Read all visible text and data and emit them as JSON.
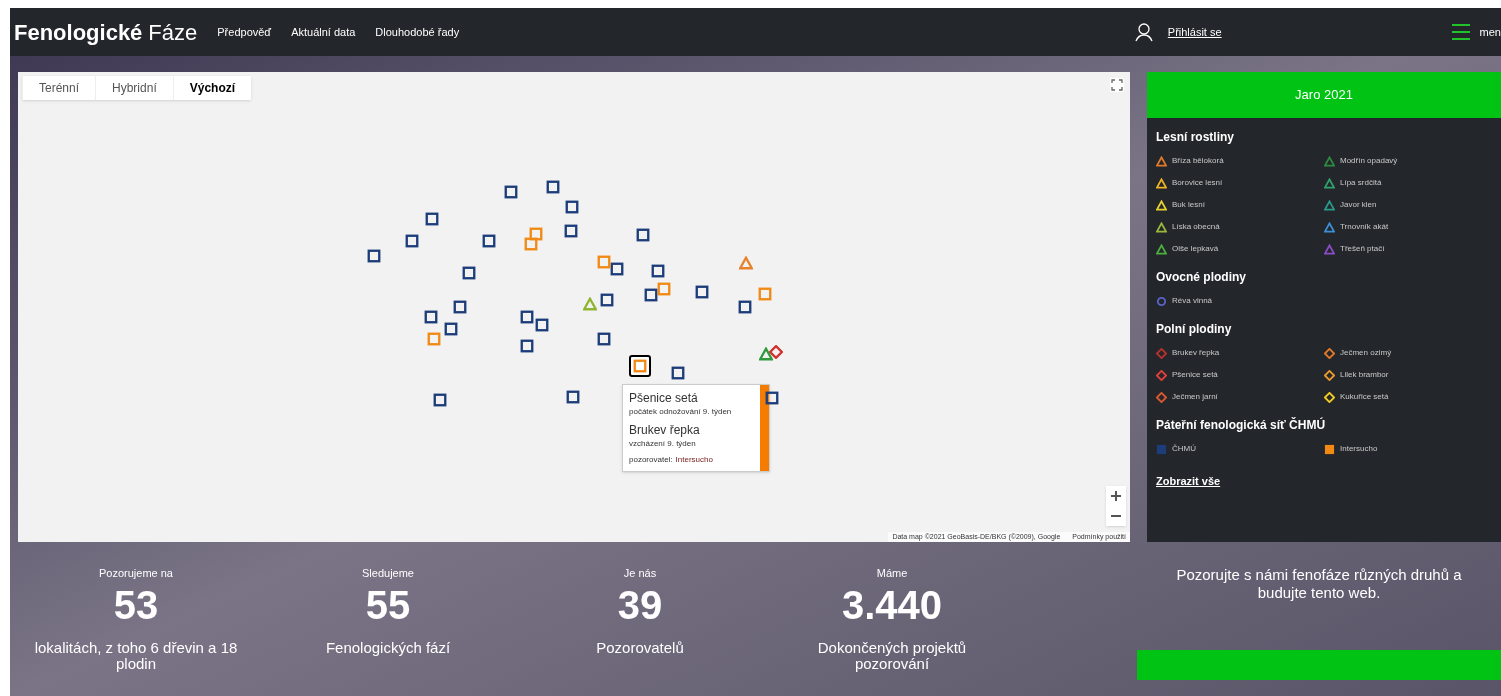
{
  "header": {
    "logo_bold": "Fenologické",
    "logo_light": "Fáze",
    "nav": [
      "Předpověď",
      "Aktuální data",
      "Dlouhodobé řady"
    ],
    "login": "Přihlásit se",
    "menu": "men"
  },
  "map": {
    "map_types": [
      {
        "label": "Terénní",
        "selected": false
      },
      {
        "label": "Hybridní",
        "selected": false
      },
      {
        "label": "Výchozí",
        "selected": true
      }
    ],
    "markers": [
      {
        "kind": "chmu",
        "selected": false
      },
      {
        "kind": "chmu",
        "selected": false
      },
      {
        "kind": "chmu",
        "selected": false
      },
      {
        "kind": "chmu",
        "selected": false
      },
      {
        "kind": "chmu",
        "selected": false
      },
      {
        "kind": "chmu",
        "selected": false
      },
      {
        "kind": "chmu",
        "selected": false
      },
      {
        "kind": "chmu",
        "selected": false
      },
      {
        "kind": "chmu",
        "selected": false
      },
      {
        "kind": "chmu",
        "selected": false
      },
      {
        "kind": "chmu",
        "selected": false
      },
      {
        "kind": "chmu",
        "selected": false
      },
      {
        "kind": "chmu",
        "selected": false
      },
      {
        "kind": "chmu",
        "selected": false
      },
      {
        "kind": "chmu",
        "selected": false
      },
      {
        "kind": "chmu",
        "selected": false
      },
      {
        "kind": "chmu",
        "selected": false
      },
      {
        "kind": "chmu",
        "selected": false
      },
      {
        "kind": "chmu",
        "selected": false
      },
      {
        "kind": "chmu",
        "selected": false
      },
      {
        "kind": "chmu",
        "selected": false
      },
      {
        "kind": "chmu",
        "selected": false
      },
      {
        "kind": "chmu",
        "selected": false
      },
      {
        "kind": "chmu",
        "selected": false
      },
      {
        "kind": "chmu",
        "selected": false
      },
      {
        "kind": "chmu",
        "selected": false
      },
      {
        "kind": "chmu",
        "selected": false
      },
      {
        "kind": "intersucho",
        "selected": false
      },
      {
        "kind": "intersucho",
        "selected": false
      },
      {
        "kind": "intersucho",
        "selected": false
      },
      {
        "kind": "intersucho",
        "selected": false
      },
      {
        "kind": "intersucho",
        "selected": false
      },
      {
        "kind": "intersucho",
        "selected": false
      },
      {
        "kind": "intersucho",
        "selected": true
      },
      {
        "kind": "triangle",
        "selected": false,
        "color": "#8fb431"
      },
      {
        "kind": "triangle",
        "selected": false,
        "color": "#e8822a"
      },
      {
        "kind": "diamond",
        "selected": false,
        "color": "#d0312d"
      },
      {
        "kind": "triangle",
        "selected": false,
        "color": "#2f9a3c"
      }
    ],
    "tooltip": {
      "entries": [
        {
          "title": "Pšenice setá",
          "detail": "počátek odnožování 9. týden"
        },
        {
          "title": "Brukev řepka",
          "detail": "vzcházení 9. týden"
        }
      ],
      "observer_label": "pozorovatel:",
      "observer": "Intersucho"
    },
    "attribution": "Data map ©2021 GeoBasis-DE/BKG (©2009), Google",
    "terms": "Podmínky použití"
  },
  "legend": {
    "title": "Jaro 2021",
    "groups": [
      {
        "name": "Lesní rostliny",
        "items": [
          {
            "label": "Bříza bělokorá",
            "kind": "triangle",
            "color": "#e07a2a"
          },
          {
            "label": "Modřín opadavý",
            "kind": "triangle",
            "color": "#2e8b3e"
          },
          {
            "label": "Borovice lesní",
            "kind": "triangle",
            "color": "#f0b323"
          },
          {
            "label": "Lípa srdčitá",
            "kind": "triangle",
            "color": "#2fa36b"
          },
          {
            "label": "Buk lesní",
            "kind": "triangle",
            "color": "#e6d22a"
          },
          {
            "label": "Javor klen",
            "kind": "triangle",
            "color": "#2a9a8a"
          },
          {
            "label": "Líska obecná",
            "kind": "triangle",
            "color": "#9ab83a"
          },
          {
            "label": "Trnovník akát",
            "kind": "triangle",
            "color": "#3b8fd6"
          },
          {
            "label": "Olše lepkavá",
            "kind": "triangle",
            "color": "#4caf3f"
          },
          {
            "label": "Třešeň ptačí",
            "kind": "triangle",
            "color": "#8b4cc7"
          }
        ]
      },
      {
        "name": "Ovocné plodiny",
        "items": [
          {
            "label": "Réva vinná",
            "kind": "circle",
            "color": "#5a63c8"
          }
        ]
      },
      {
        "name": "Polní plodiny",
        "items": [
          {
            "label": "Brukev řepka",
            "kind": "diamond",
            "color": "#b8302b"
          },
          {
            "label": "Ječmen ozimý",
            "kind": "diamond",
            "color": "#e0782a"
          },
          {
            "label": "Pšenice setá",
            "kind": "diamond",
            "color": "#e0403a"
          },
          {
            "label": "Lilek brambor",
            "kind": "diamond",
            "color": "#e8992a"
          },
          {
            "label": "Ječmen jarní",
            "kind": "diamond",
            "color": "#d9582f"
          },
          {
            "label": "Kukuřice setá",
            "kind": "diamond",
            "color": "#f0cc20"
          }
        ]
      },
      {
        "name": "Páteřní fenologická síť ČHMÚ",
        "items": [
          {
            "label": "ČHMÚ",
            "kind": "square",
            "color": "#1c3d7a"
          },
          {
            "label": "Intersucho",
            "kind": "square",
            "color": "#f08a14"
          }
        ]
      }
    ],
    "show_all": "Zobrazit vše"
  },
  "stats": [
    {
      "caption": "Pozorujeme na",
      "number": "53",
      "label": "lokalitách, z toho 6 dřevin a 18 plodin"
    },
    {
      "caption": "Sledujeme",
      "number": "55",
      "label": "Fenologických fází"
    },
    {
      "caption": "Je nás",
      "number": "39",
      "label": "Pozorovatelů"
    },
    {
      "caption": "Máme",
      "number": "3.440",
      "label": "Dokončených projektů pozorování"
    }
  ],
  "promo": "Pozorujte s námi fenofáze různých druhů a budujte tento web."
}
